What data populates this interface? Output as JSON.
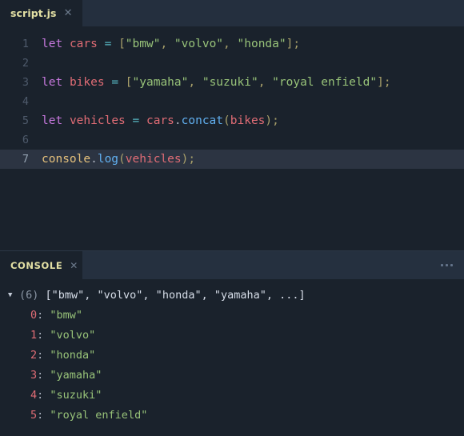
{
  "editor": {
    "tab": {
      "label": "script.js",
      "close_icon": "close-icon"
    },
    "lines": [
      {
        "number": "1",
        "current": false,
        "tokens": [
          {
            "t": "kw",
            "v": "let"
          },
          {
            "t": "plain",
            "v": " "
          },
          {
            "t": "var",
            "v": "cars"
          },
          {
            "t": "plain",
            "v": " "
          },
          {
            "t": "op",
            "v": "="
          },
          {
            "t": "plain",
            "v": " "
          },
          {
            "t": "pun",
            "v": "["
          },
          {
            "t": "str",
            "v": "\"bmw\""
          },
          {
            "t": "pun",
            "v": ","
          },
          {
            "t": "plain",
            "v": " "
          },
          {
            "t": "str",
            "v": "\"volvo\""
          },
          {
            "t": "pun",
            "v": ","
          },
          {
            "t": "plain",
            "v": " "
          },
          {
            "t": "str",
            "v": "\"honda\""
          },
          {
            "t": "pun",
            "v": "];"
          }
        ]
      },
      {
        "number": "2",
        "current": false,
        "tokens": []
      },
      {
        "number": "3",
        "current": false,
        "tokens": [
          {
            "t": "kw",
            "v": "let"
          },
          {
            "t": "plain",
            "v": " "
          },
          {
            "t": "var",
            "v": "bikes"
          },
          {
            "t": "plain",
            "v": " "
          },
          {
            "t": "op",
            "v": "="
          },
          {
            "t": "plain",
            "v": " "
          },
          {
            "t": "pun",
            "v": "["
          },
          {
            "t": "str",
            "v": "\"yamaha\""
          },
          {
            "t": "pun",
            "v": ","
          },
          {
            "t": "plain",
            "v": " "
          },
          {
            "t": "str",
            "v": "\"suzuki\""
          },
          {
            "t": "pun",
            "v": ","
          },
          {
            "t": "plain",
            "v": " "
          },
          {
            "t": "str",
            "v": "\"royal enfield\""
          },
          {
            "t": "pun",
            "v": "];"
          }
        ]
      },
      {
        "number": "4",
        "current": false,
        "tokens": []
      },
      {
        "number": "5",
        "current": false,
        "tokens": [
          {
            "t": "kw",
            "v": "let"
          },
          {
            "t": "plain",
            "v": " "
          },
          {
            "t": "var",
            "v": "vehicles"
          },
          {
            "t": "plain",
            "v": " "
          },
          {
            "t": "op",
            "v": "="
          },
          {
            "t": "plain",
            "v": " "
          },
          {
            "t": "var",
            "v": "cars"
          },
          {
            "t": "plain",
            "v": "."
          },
          {
            "t": "fn",
            "v": "concat"
          },
          {
            "t": "pun",
            "v": "("
          },
          {
            "t": "var",
            "v": "bikes"
          },
          {
            "t": "pun",
            "v": ");"
          }
        ]
      },
      {
        "number": "6",
        "current": false,
        "tokens": []
      },
      {
        "number": "7",
        "current": true,
        "tokens": [
          {
            "t": "obj",
            "v": "console"
          },
          {
            "t": "plain",
            "v": "."
          },
          {
            "t": "fn",
            "v": "log"
          },
          {
            "t": "pun",
            "v": "("
          },
          {
            "t": "var",
            "v": "vehicles"
          },
          {
            "t": "pun",
            "v": ");"
          }
        ]
      }
    ]
  },
  "console": {
    "tab": {
      "label": "CONSOLE",
      "close_icon": "close-icon"
    },
    "menu_icon": "more-options-icon",
    "output": {
      "caret": "▼",
      "count": "(6)",
      "preview": "[\"bmw\", \"volvo\", \"honda\", \"yamaha\", ...]",
      "entries": [
        {
          "index": "0",
          "value": "\"bmw\""
        },
        {
          "index": "1",
          "value": "\"volvo\""
        },
        {
          "index": "2",
          "value": "\"honda\""
        },
        {
          "index": "3",
          "value": "\"yamaha\""
        },
        {
          "index": "4",
          "value": "\"suzuki\""
        },
        {
          "index": "5",
          "value": "\"royal enfield\""
        }
      ]
    }
  },
  "colors": {
    "editor_bg": "#1a222c",
    "tabbar_bg": "#242f3e",
    "console_header_bg": "#25303f",
    "current_line_bg": "#2c3442",
    "tab_label": "#e3e0a4",
    "keyword": "#c678dd",
    "variable": "#e06c75",
    "operator": "#56b6c2",
    "string": "#98c379",
    "function": "#61afef",
    "object": "#e5c07b",
    "punctuation": "#a8a06a"
  }
}
